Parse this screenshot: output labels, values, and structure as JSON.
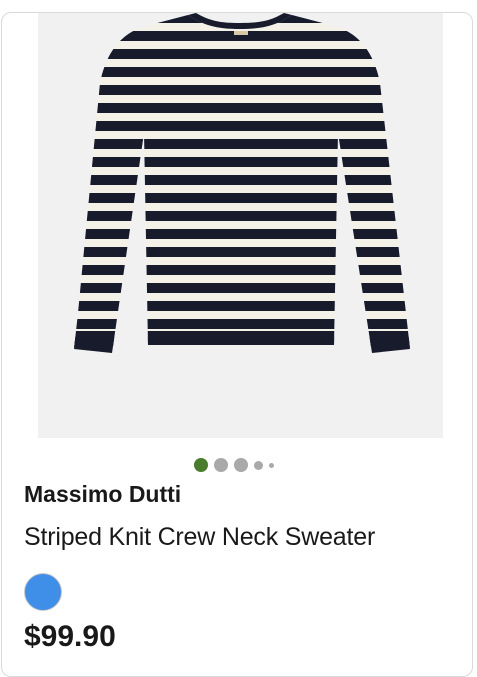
{
  "product": {
    "brand": "Massimo Dutti",
    "title": "Striped Knit Crew Neck Sweater",
    "price": "$99.90",
    "image_icon": "striped-sweater-image"
  },
  "carousel": {
    "active_index": 0,
    "total_visible_dots": 5
  },
  "colors": {
    "active_dot": "#4a7c2e",
    "inactive_dot": "#a9a9a9",
    "swatch": "#3f8ee8",
    "sweater_dark": "#171b2c",
    "sweater_light": "#f4f1e8",
    "image_bg": "#f1f1f1"
  }
}
